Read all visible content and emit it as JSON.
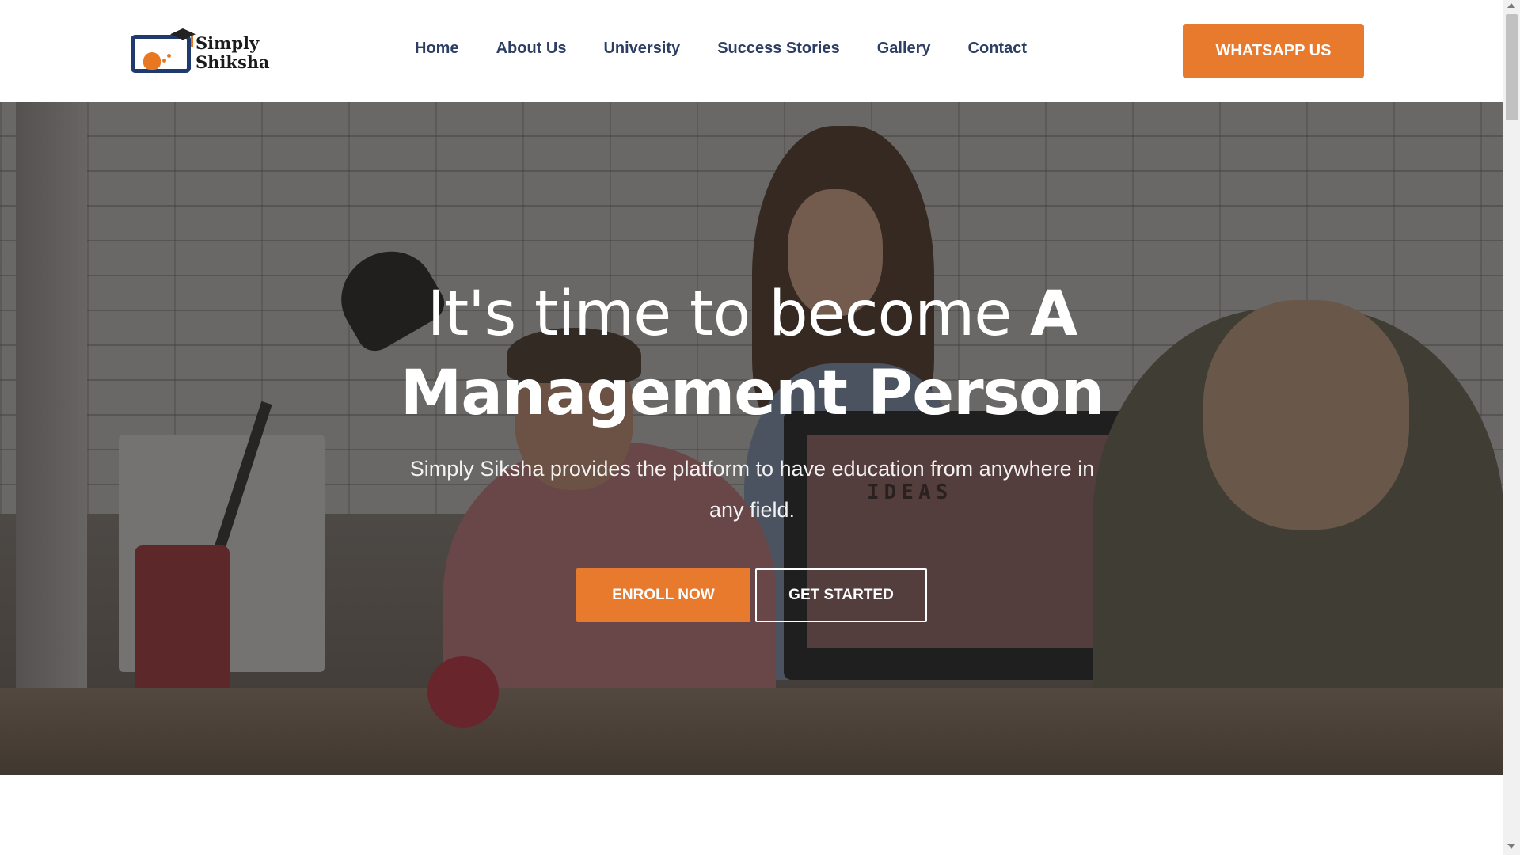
{
  "brand": {
    "line1": "Simply",
    "line2": "Shiksha",
    "accent_color": "#e87a2e",
    "navy_color": "#1e3a6e"
  },
  "nav": {
    "items": [
      {
        "label": "Home"
      },
      {
        "label": "About Us"
      },
      {
        "label": "University"
      },
      {
        "label": "Success Stories"
      },
      {
        "label": "Gallery"
      },
      {
        "label": "Contact"
      }
    ],
    "text_color": "#2c3e63"
  },
  "header": {
    "whatsapp_label": "WHATSAPP US"
  },
  "hero": {
    "title_light": "It's time to become ",
    "title_bold_a": "A",
    "title_bold_b": "Management Person",
    "subtitle": "Simply Siksha provides the platform to have education from anywhere in any field.",
    "screen_text": "IDEAS",
    "enroll_label": "ENROLL NOW",
    "started_label": "GET STARTED"
  },
  "icons": {
    "logo": "graduation-cap-screen-icon",
    "scroll_up": "arrow-up-icon",
    "scroll_down": "arrow-down-icon"
  }
}
